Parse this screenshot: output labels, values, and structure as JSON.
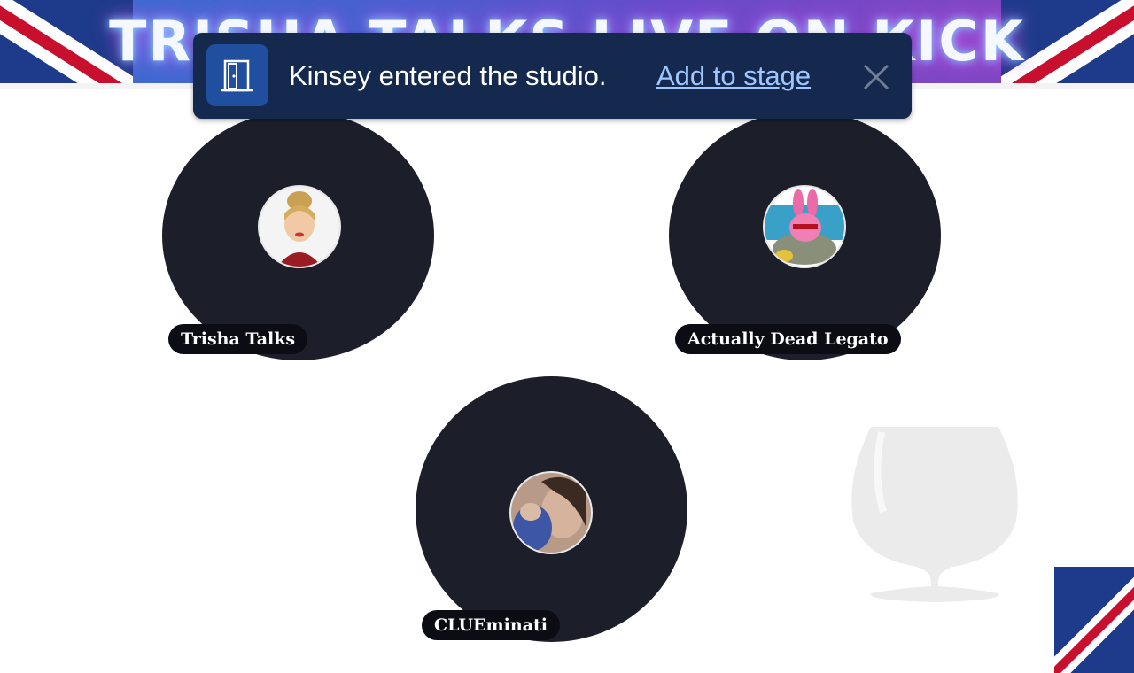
{
  "banner": {
    "title": "TRISHA TALKS LIVE ON KICK"
  },
  "notification": {
    "message": "Kinsey entered the studio.",
    "action_label": "Add to stage",
    "icon": "door-icon",
    "close_icon": "close-icon"
  },
  "participants": [
    {
      "name": "Trisha Talks"
    },
    {
      "name": "Actually Dead Legato"
    },
    {
      "name": "CLUEminati"
    }
  ],
  "colors": {
    "toast_bg": "#15294f",
    "tile_bg": "#1c1f2a",
    "link": "#9fc6ff"
  }
}
